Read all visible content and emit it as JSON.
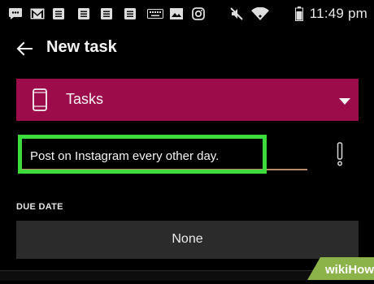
{
  "status_bar": {
    "time": "11:49 pm",
    "icons": [
      "chat-icon",
      "gmail-icon",
      "notes-icon",
      "notes-icon",
      "notes-icon",
      "notes-icon",
      "keyboard-icon",
      "image-icon",
      "instagram-icon",
      "mute-icon",
      "wifi-icon",
      "battery-icon"
    ]
  },
  "app_bar": {
    "title": "New task",
    "back_icon": "arrow-back-icon"
  },
  "list_selector": {
    "icon": "phone-icon",
    "label": "Tasks",
    "dropdown_icon": "triangle-down-icon"
  },
  "task": {
    "text": "Post on Instagram every other day.",
    "priority_icon": "exclamation-icon"
  },
  "due_date": {
    "label": "DUE DATE",
    "value": "None"
  },
  "watermark": {
    "text": "wikiHow"
  },
  "colors": {
    "background": "#000000",
    "list_selector": "#9c0c4b",
    "highlight": "#3bdc3b",
    "underline": "#b98a6a",
    "due_button": "#2b2b2b"
  }
}
